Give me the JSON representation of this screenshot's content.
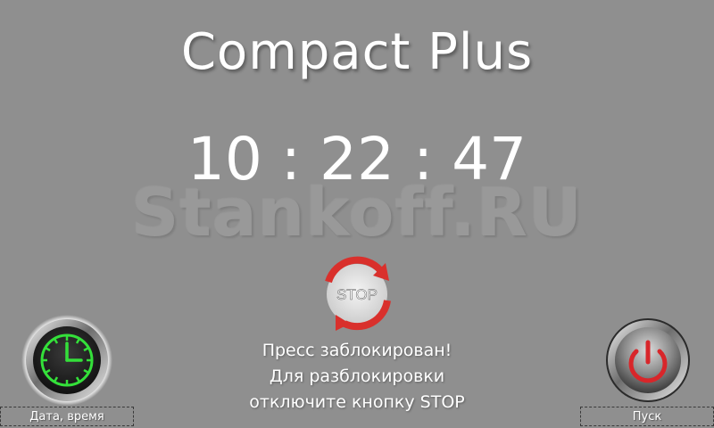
{
  "header": {
    "title": "Compact Plus"
  },
  "clock": {
    "time": "10 : 22 : 47"
  },
  "watermark": {
    "text": "Stankoff.RU"
  },
  "status": {
    "stop_badge": "STOP",
    "message_lines": [
      "Пресс заблокирован!",
      "Для разблокировки",
      "отключите кнопку STOP"
    ]
  },
  "buttons": {
    "datetime_label": "Дата, время",
    "start_label": "Пуск"
  },
  "colors": {
    "background": "#8f8f8f",
    "stop_arrows": "#d9302c",
    "clock_icon": "#34e03a",
    "power_icon": "#d8262a"
  },
  "icons": {
    "datetime": "clock-icon",
    "start": "power-icon",
    "status": "stop-cycle-icon"
  }
}
